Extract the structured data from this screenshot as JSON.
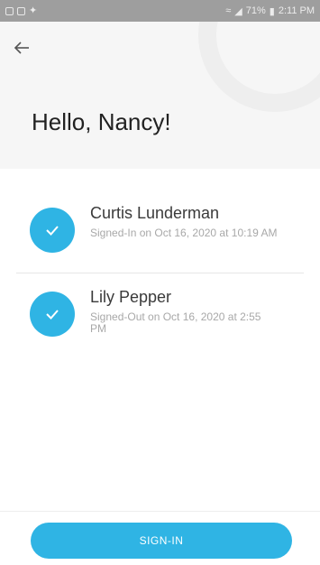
{
  "status_bar": {
    "battery": "71%",
    "time": "2:11 PM"
  },
  "header": {
    "greeting": "Hello, Nancy!"
  },
  "entries": [
    {
      "name": "Curtis Lunderman",
      "status": "Signed-In on Oct 16, 2020 at 10:19 AM"
    },
    {
      "name": "Lily Pepper",
      "status": "Signed-Out on Oct 16, 2020 at 2:55 PM"
    }
  ],
  "footer": {
    "sign_in_label": "SIGN-IN"
  },
  "colors": {
    "accent": "#2fb4e4",
    "header_bg": "#f6f6f6",
    "status_bar_bg": "#9e9e9e"
  }
}
